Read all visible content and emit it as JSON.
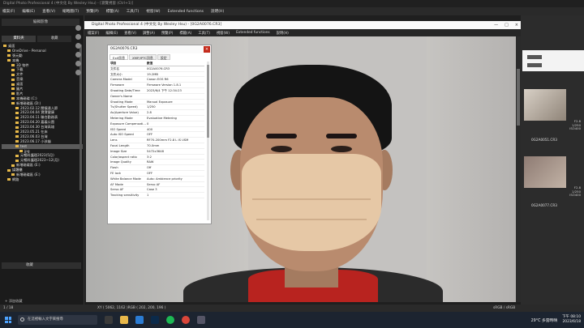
{
  "outer_window": {
    "title": "Digital Photo Professional 4 (中文化 By Wesley Hsu) - [瀏覽視窗 (Ctrl+1)]",
    "menu": [
      "檔案(F)",
      "編輯(E)",
      "查看(V)",
      "縮略圖(T)",
      "預覽(P)",
      "標籤(A)",
      "工具(T)",
      "視窗(W)",
      "Extended functions",
      "說明(H)"
    ]
  },
  "left_panel": {
    "header": "編輯影像",
    "tabs": [
      "資料夾",
      "收藏"
    ],
    "tree": [
      "桌面",
      "OneDrive - Personal",
      "張元勳",
      "本機",
      "3D 物件",
      "下載",
      "文件",
      "音樂",
      "桌面",
      "圖片",
      "影片",
      "本機磁碟 (C:)",
      "新增磁碟區 (D:)",
      "2023.02.12 關懷達人節",
      "2023.04.04 寶寶健康",
      "2023.04.11 聯合勤務表",
      "2023.04.20 嘉義公園",
      "2023.04.30 台灣高雄",
      "2023.05.21 在床",
      "2023.06.03 台灣",
      "2023.06.17 小孩貓",
      "test",
      "jpg",
      "元暢科護理2023(5月)",
      "元暢科護理2023~12(月)",
      "新增磁碟區 (E:)",
      "媒體櫃",
      "新增磁碟區 (E:)",
      "網路"
    ],
    "favorites_header": "收藏",
    "add_favorite": "+ 添加收藏"
  },
  "inner_window": {
    "title": "Digital Photo Professional 4 (中文化 By Wesley Hsu) - [0G2A0076.CR3]",
    "menu": [
      "檔案(F)",
      "編輯(E)",
      "查看(V)",
      "調整(A)",
      "預覽(P)",
      "標籤(A)",
      "工具(T)",
      "視窗(W)",
      "Extended functions",
      "說明(H)"
    ]
  },
  "info_window": {
    "title": "0G2A0076.CR3",
    "close": "×",
    "tabs": [
      "Exif訊息",
      "XMP/IPTC訊息",
      "設定"
    ],
    "header": {
      "k": "項目",
      "v": "數值"
    },
    "rows": [
      {
        "k": "文件名",
        "v": "0G2A0076.CR3"
      },
      {
        "k": "文件大小",
        "v": "19.2MB"
      },
      {
        "k": "Camera Model",
        "v": "Canon EOS R6"
      },
      {
        "k": "Firmware",
        "v": "Firmware Version 1.8.1"
      },
      {
        "k": "Shooting Date/Time",
        "v": "2023/6/4 下午 12:34:23"
      },
      {
        "k": "Owner's Name",
        "v": ""
      },
      {
        "k": "Shooting Mode",
        "v": "Manual Exposure"
      },
      {
        "k": "Tv(Shutter Speed)",
        "v": "1/250"
      },
      {
        "k": "Av(Aperture Value)",
        "v": "2.8"
      },
      {
        "k": "Metering Mode",
        "v": "Evaluative Metering"
      },
      {
        "k": "Exposure Compensati…",
        "v": "0"
      },
      {
        "k": "ISO Speed",
        "v": "400"
      },
      {
        "k": "Auto ISO Speed",
        "v": "OFF"
      },
      {
        "k": "Lens",
        "v": "RF70-200mm F2.8 L IS USM"
      },
      {
        "k": "Focal Length",
        "v": "70.0mm"
      },
      {
        "k": "Image Size",
        "v": "5472x3648"
      },
      {
        "k": "Color/aspect ratio",
        "v": "3:2"
      },
      {
        "k": "Image Quality",
        "v": "RAW"
      },
      {
        "k": "Flash",
        "v": "Off"
      },
      {
        "k": "FE lock",
        "v": "OFF"
      },
      {
        "k": "White Balance Mode",
        "v": "Auto: Ambience priority"
      },
      {
        "k": "AF Mode",
        "v": "Servo AF"
      },
      {
        "k": "Servo AF",
        "v": "Case 3"
      },
      {
        "k": "Tracking sensitivity",
        "v": "1"
      }
    ]
  },
  "thumbnails": [
    {
      "label": "0G2A0051.CR3",
      "meta": [
        "F2.8",
        "1/250",
        "ISO400"
      ]
    },
    {
      "label": "0G2A0077.CR3",
      "meta": [
        "F2.8",
        "1/250",
        "ISO400"
      ]
    }
  ],
  "status": {
    "count": "1 / 18",
    "coords": "XY ( 5062, 1162 )RGB ( 202, 200, 196 )",
    "profile": "sRGB / sRGB"
  },
  "taskbar": {
    "search_placeholder": "在這裡輸入文字來搜尋",
    "weather": "29°C 多雲時晴",
    "time": "下午 08:10",
    "date": "2023/6/18"
  }
}
